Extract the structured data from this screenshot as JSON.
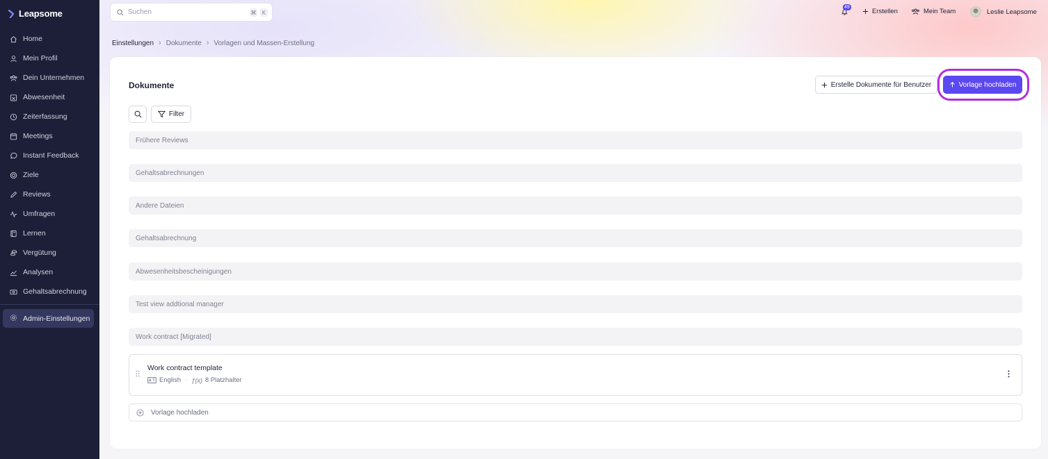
{
  "app": {
    "brand": "Leapsome"
  },
  "sidebar": {
    "items": [
      {
        "label": "Home",
        "icon": "home-icon"
      },
      {
        "label": "Mein Profil",
        "icon": "user-icon"
      },
      {
        "label": "Dein Unternehmen",
        "icon": "company-icon"
      },
      {
        "label": "Abwesenheit",
        "icon": "absence-icon"
      },
      {
        "label": "Zeiterfassung",
        "icon": "clock-icon"
      },
      {
        "label": "Meetings",
        "icon": "calendar-icon"
      },
      {
        "label": "Instant Feedback",
        "icon": "chat-icon"
      },
      {
        "label": "Ziele",
        "icon": "target-icon"
      },
      {
        "label": "Reviews",
        "icon": "pen-icon"
      },
      {
        "label": "Umfragen",
        "icon": "pulse-icon"
      },
      {
        "label": "Lernen",
        "icon": "book-icon"
      },
      {
        "label": "Vergütung",
        "icon": "coins-icon"
      },
      {
        "label": "Analysen",
        "icon": "chart-icon"
      },
      {
        "label": "Gehaltsabrechnung",
        "icon": "payroll-icon"
      }
    ],
    "admin": {
      "label": "Admin-Einstellungen",
      "icon": "gear-icon"
    }
  },
  "search": {
    "placeholder": "Suchen",
    "shortcut_mod": "⌘",
    "shortcut_key": "K"
  },
  "topbar": {
    "notification_count": "49",
    "create_label": "Erstellen",
    "team_label": "Mein Team",
    "user_name": "Leslie Leapsome"
  },
  "breadcrumb": {
    "items": [
      "Einstellungen",
      "Dokumente",
      "Vorlagen und Massen-Erstellung"
    ]
  },
  "main": {
    "title": "Dokumente",
    "create_docs_label": "Erstelle Dokumente für Benutzer",
    "upload_label": "Vorlage hochladen",
    "filter_label": "Filter",
    "groups": [
      "Frühere Reviews",
      "Gehaltsabrechnungen",
      "Andere Dateien",
      "Gehaltsabrechnung",
      "Abwesenheitsbescheinigungen",
      "Test view addtional manager",
      "Work contract [Migrated]"
    ],
    "template": {
      "name": "Work contract template",
      "language": "English",
      "placeholders": "8 Platzhalter"
    },
    "add_template_label": "Vorlage hochladen"
  },
  "colors": {
    "accent": "#5b48f0",
    "sidebar_bg": "#1d1f38",
    "highlight": "#b22ee0"
  }
}
